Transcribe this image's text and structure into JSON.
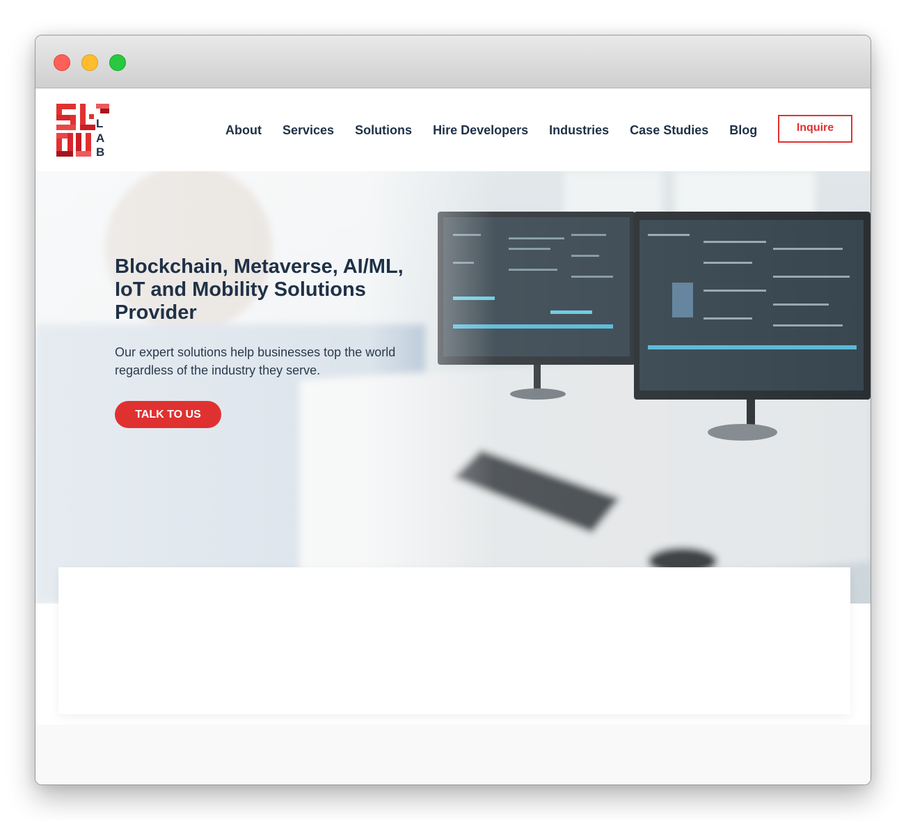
{
  "window": {
    "controls": [
      "close",
      "minimize",
      "maximize"
    ]
  },
  "header": {
    "logo": {
      "alt": "SolDU Lab",
      "letters": [
        "L",
        "A",
        "B"
      ],
      "brand_color": "#e03131"
    },
    "nav": [
      {
        "label": "About"
      },
      {
        "label": "Services"
      },
      {
        "label": "Solutions"
      },
      {
        "label": "Hire Developers"
      },
      {
        "label": "Industries"
      },
      {
        "label": "Case Studies"
      },
      {
        "label": "Blog"
      }
    ],
    "inquire_label": "Inquire"
  },
  "hero": {
    "title": "Blockchain, Metaverse, AI/ML, IoT and Mobility Solutions Provider",
    "subtitle": "Our expert solutions help businesses top the world regardless of the industry they serve.",
    "cta_label": "TALK TO US",
    "background": "developer-at-dual-monitors-photo"
  },
  "colors": {
    "accent": "#e03131",
    "text_dark": "#1f3147"
  }
}
